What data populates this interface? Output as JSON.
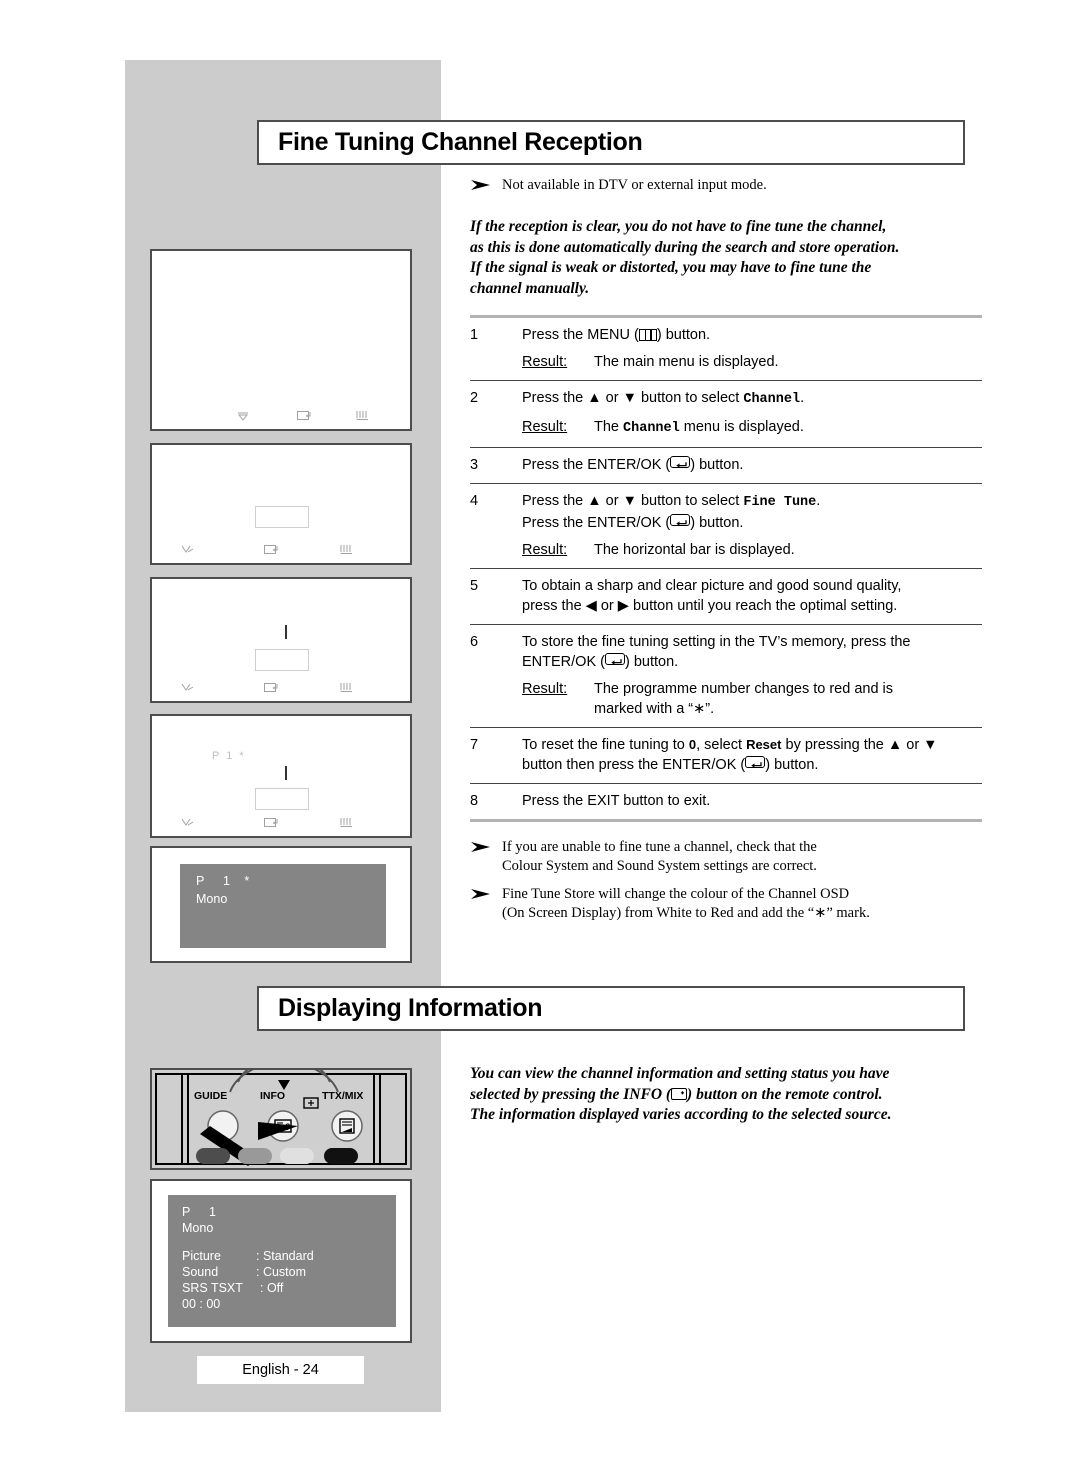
{
  "page": {
    "footer_label": "English - 24",
    "band_color": "#cccccc",
    "osd_screen_color": "#858585"
  },
  "sections": [
    {
      "id": "fine-tuning",
      "title": "Fine Tuning Channel Reception"
    },
    {
      "id": "displaying-info",
      "title": "Displaying Information"
    }
  ],
  "fine_tuning": {
    "top_note": "Not available in DTV or external input mode.",
    "intro": [
      "If the reception is clear, you do not have to fine tune the channel,",
      "as this is done automatically during the search and store operation.",
      "If the signal is weak or distorted, you may have to fine tune the",
      "channel manually."
    ],
    "steps": [
      {
        "num": "1",
        "lines": [
          {
            "pre": "Press the MENU (",
            "icon": "menu-icon",
            "post": ") button."
          }
        ],
        "result": {
          "label": "Result:",
          "text": "The main menu is displayed."
        }
      },
      {
        "num": "2",
        "lines": [
          {
            "pre": "Press the ▲ or ▼ button to select ",
            "mono": "Channel",
            "post": "."
          }
        ],
        "result": {
          "label": "Result:",
          "pre": "The ",
          "mono": "Channel",
          "post": " menu is displayed."
        }
      },
      {
        "num": "3",
        "lines": [
          {
            "pre": "Press the ENTER/OK (",
            "icon": "enter-ok-icon",
            "post": ") button."
          }
        ]
      },
      {
        "num": "4",
        "lines": [
          {
            "pre": "Press the ▲ or ▼ button to select ",
            "mono": "Fine Tune",
            "post": "."
          },
          {
            "pre": "Press the ENTER/OK (",
            "icon": "enter-ok-icon",
            "post": ") button."
          }
        ],
        "result": {
          "label": "Result:",
          "text": "The horizontal bar is displayed."
        }
      },
      {
        "num": "5",
        "lines": [
          {
            "pre": "To obtain a sharp and clear picture and good sound quality,"
          },
          {
            "pre": "press the ◀ or ▶ button until you reach the optimal setting."
          }
        ]
      },
      {
        "num": "6",
        "lines": [
          {
            "pre": "To store the fine tuning setting in the TV’s memory, press the"
          },
          {
            "pre": "ENTER/OK (",
            "icon": "enter-ok-icon",
            "post": ") button."
          }
        ],
        "result": {
          "label": "Result:",
          "text": "The programme number changes to red and is",
          "text2": "marked with a “∗”."
        }
      },
      {
        "num": "7",
        "lines": [
          {
            "pre": "To reset the fine tuning to ",
            "small_bold": "0",
            "mid": ", select ",
            "small_bold2": "Reset",
            "post2": " by pressing the ▲ or ▼"
          },
          {
            "pre": "button then press the ENTER/OK (",
            "icon": "enter-ok-icon",
            "post": ") button."
          }
        ]
      },
      {
        "num": "8",
        "lines": [
          {
            "pre": "Press the EXIT button to exit."
          }
        ]
      }
    ],
    "after_notes": [
      [
        "If you are unable to fine tune a channel, check that the",
        "Colour System and Sound System settings are correct."
      ],
      [
        "Fine Tune Store will change the colour of the Channel OSD",
        "(On Screen Display) from White to Red and add the “∗” mark."
      ]
    ]
  },
  "displaying_info": {
    "intro": [
      {
        "pre": "You can view the channel information and setting status you have"
      },
      {
        "pre": "selected by pressing the INFO (",
        "icon": "info-icon",
        "post": ") button on the remote control."
      },
      {
        "pre": "The information displayed varies according to the selected source."
      }
    ]
  },
  "illustrations": [
    {
      "name": "menu-main-screen",
      "osd": [],
      "has_bar": false,
      "has_tick": false,
      "footer_icons": [
        "move-down-icon",
        "enter-icon",
        "menu-return-icon"
      ]
    },
    {
      "name": "channel-menu-screen",
      "osd": [],
      "has_bar": true,
      "has_tick": false,
      "footer_icons": [
        "adjust-icon",
        "enter-icon",
        "menu-return-icon"
      ]
    },
    {
      "name": "fine-tune-bar-screen",
      "osd": [],
      "has_bar": true,
      "has_tick": true,
      "footer_icons": [
        "adjust-icon",
        "enter-icon",
        "menu-return-icon"
      ]
    },
    {
      "name": "fine-tune-stored-screen",
      "osd": [
        "P  1  *"
      ],
      "has_bar": true,
      "has_tick": true,
      "footer_icons": [
        "adjust-icon",
        "enter-icon",
        "menu-return-icon"
      ]
    }
  ],
  "osd_boxes": [
    {
      "name": "osd-programme-marked",
      "lines": [
        "P    1   *",
        "Mono"
      ]
    },
    {
      "name": "osd-info-display",
      "lines": [
        "P    1",
        "Mono"
      ],
      "rows": [
        {
          "label": "Picture",
          "value": ": Standard"
        },
        {
          "label": "Sound",
          "value": ": Custom"
        },
        {
          "label": "SRS TSXT",
          "value": ": Off"
        }
      ],
      "clock": "00 : 00"
    }
  ],
  "remote": {
    "buttons": [
      {
        "label": "GUIDE",
        "name": "guide-button"
      },
      {
        "label": "INFO",
        "name": "info-button"
      },
      {
        "label": "TTX/MIX",
        "name": "ttx-mix-button"
      }
    ]
  }
}
